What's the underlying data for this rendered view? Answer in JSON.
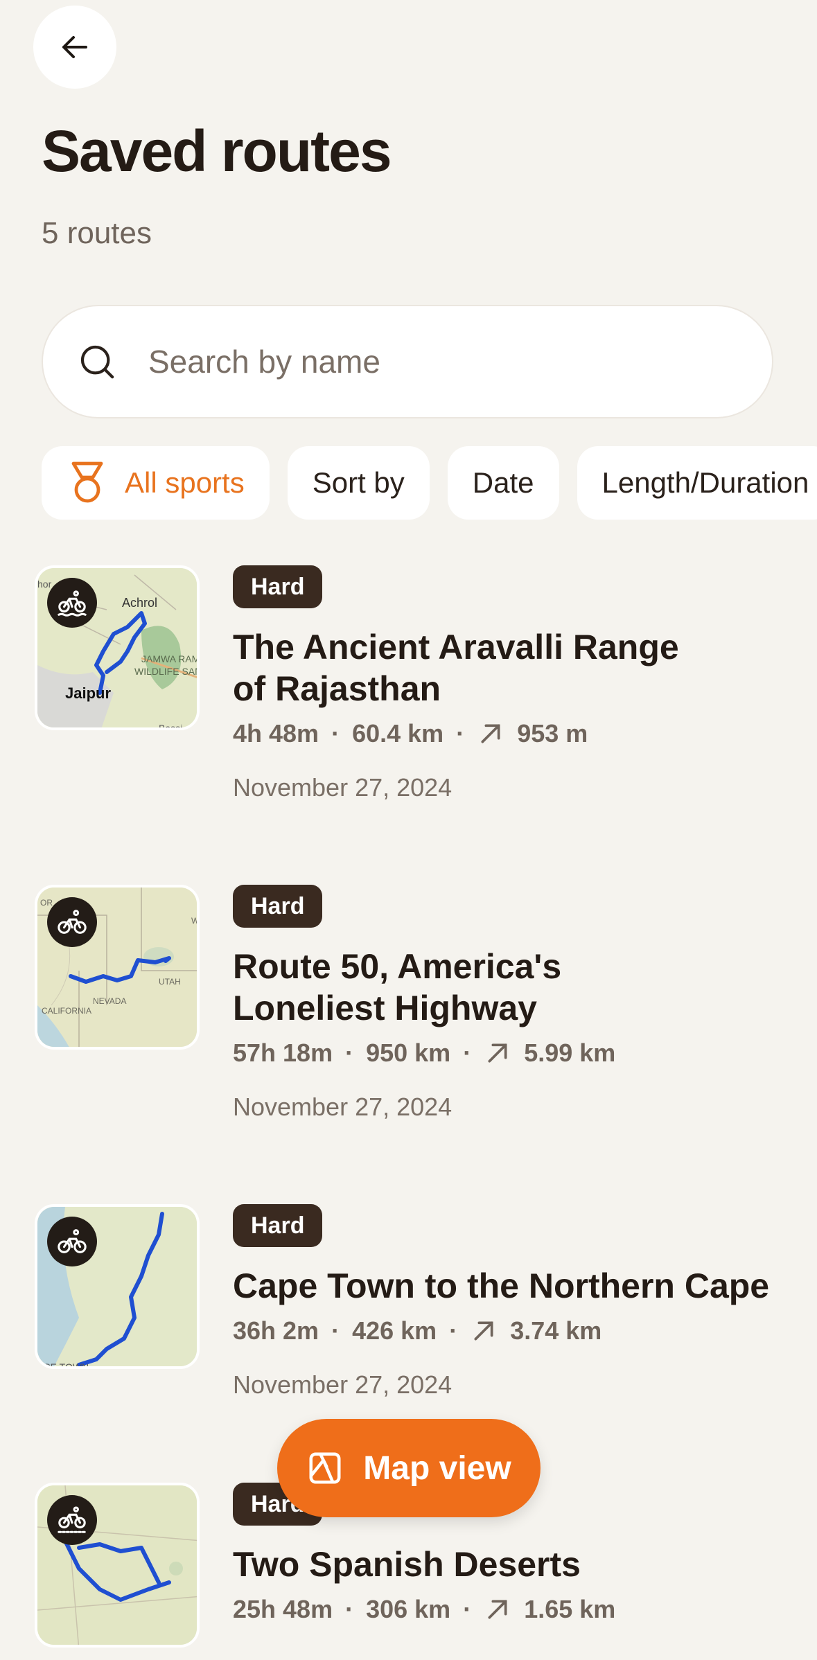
{
  "header": {
    "title": "Saved routes",
    "count": "5 routes"
  },
  "search": {
    "placeholder": "Search by name"
  },
  "filters": [
    {
      "label": "All sports",
      "active": true
    },
    {
      "label": "Sort by",
      "active": false
    },
    {
      "label": "Date",
      "active": false
    },
    {
      "label": "Length/Duration",
      "active": false
    }
  ],
  "routes": [
    {
      "badge": "Hard",
      "name_line1": "The Ancient Aravalli Range",
      "name_line2": "of Rajasthan",
      "duration": "4h 48m",
      "distance": "60.4 km",
      "elevation": "953 m",
      "date": "November 27, 2024",
      "sport": "gravel-bike-icon",
      "map_labels": [
        "Achrol",
        "Jaipur",
        "JAMWA RAMG",
        "WILDLIFE SANC",
        "Bassi",
        "hor"
      ]
    },
    {
      "badge": "Hard",
      "name_line1": "Route 50, America's",
      "name_line2": "Loneliest Highway",
      "duration": "57h 18m",
      "distance": "950 km",
      "elevation": "5.99 km",
      "date": "November 27, 2024",
      "sport": "bike-icon",
      "map_labels": [
        "NEVADA",
        "UTAH",
        "CALIFORNIA",
        "OR",
        "W"
      ]
    },
    {
      "badge": "Hard",
      "name_line1": "Cape Town to the Northern Cape",
      "name_line2": "",
      "duration": "36h 2m",
      "distance": "426 km",
      "elevation": "3.74 km",
      "date": "November 27, 2024",
      "sport": "bike-icon",
      "map_labels": [
        "APE TOWN"
      ]
    },
    {
      "badge": "Hard",
      "name_line1": "Two Spanish Deserts",
      "name_line2": "",
      "duration": "25h 48m",
      "distance": "306 km",
      "elevation": "1.65 km",
      "date": "",
      "sport": "mtb-icon",
      "map_labels": []
    }
  ],
  "fab": {
    "label": "Map view"
  },
  "colors": {
    "accent": "#ef6e1a",
    "badge": "#3a2a20",
    "route_line": "#1f4fd1"
  }
}
